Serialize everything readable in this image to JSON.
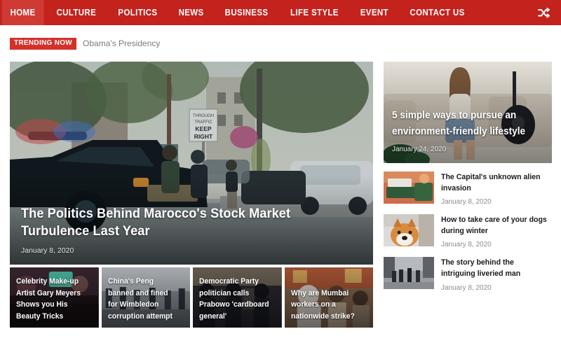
{
  "nav": {
    "items": [
      {
        "label": "HOME",
        "active": true
      },
      {
        "label": "CULTURE",
        "active": false
      },
      {
        "label": "POLITICS",
        "active": false
      },
      {
        "label": "NEWS",
        "active": false
      },
      {
        "label": "BUSINESS",
        "active": false
      },
      {
        "label": "LIFE STYLE",
        "active": false
      },
      {
        "label": "EVENT",
        "active": false
      },
      {
        "label": "CONTACT US",
        "active": false
      }
    ],
    "shuffle_icon": "shuffle-icon",
    "background_color": "#c4221d",
    "active_color": "#cf3b34"
  },
  "trending": {
    "badge": "TRENDING NOW",
    "badge_color": "#d6302a",
    "headline": "Obama's Presidency"
  },
  "hero": {
    "title": "The Politics Behind Marocco's Stock Market Turbulence Last Year",
    "date": "January 8, 2020"
  },
  "thumbnails": [
    {
      "title": "Celebrity Make-up Artist Gary Meyers Shows you His Beauty Tricks"
    },
    {
      "title": "China's Peng banned and fined for Wimbledon corruption attempt"
    },
    {
      "title": "Democratic Party politician calls Prabowo 'cardboard general'"
    },
    {
      "title": "Why are Mumbai workers on a nationwide strike?"
    }
  ],
  "sidebar": {
    "feature": {
      "title_line1": "5 simple ways to pursue an",
      "title_line2": "environment-friendly lifestyle",
      "date": "January 24, 2020"
    },
    "items": [
      {
        "title": "The Capital's unknown alien invasion",
        "date": "January 8, 2020"
      },
      {
        "title": "How to take care of your dogs during winter",
        "date": "January 8, 2020"
      },
      {
        "title": "The story behind the intriguing liveried man",
        "date": "January 8, 2020"
      }
    ]
  }
}
